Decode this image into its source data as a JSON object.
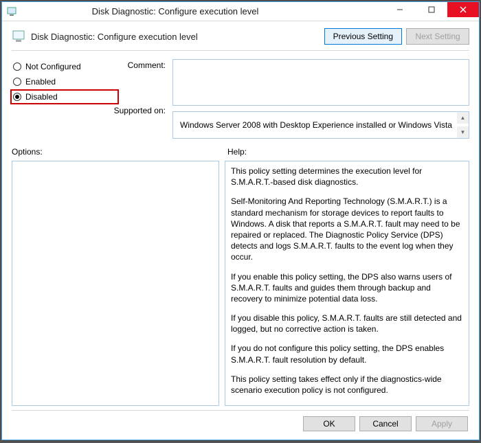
{
  "window": {
    "title": "Disk Diagnostic: Configure execution level"
  },
  "header": {
    "title": "Disk Diagnostic: Configure execution level",
    "prev_btn": "Previous Setting",
    "next_btn": "Next Setting"
  },
  "radios": {
    "not_configured": "Not Configured",
    "enabled": "Enabled",
    "disabled": "Disabled",
    "selected": "disabled"
  },
  "labels": {
    "comment": "Comment:",
    "supported": "Supported on:",
    "options": "Options:",
    "help": "Help:"
  },
  "supported_text": "Windows Server 2008 with Desktop Experience installed or Windows Vista",
  "help": {
    "p1": "This policy setting determines the execution level for S.M.A.R.T.-based disk diagnostics.",
    "p2": "Self-Monitoring And Reporting Technology (S.M.A.R.T.) is a standard mechanism for storage devices to report faults to Windows. A disk that reports a S.M.A.R.T. fault may need to be repaired or replaced. The Diagnostic Policy Service (DPS) detects and logs S.M.A.R.T. faults to the event log when they occur.",
    "p3": "If you enable this policy setting, the DPS also warns users of S.M.A.R.T. faults and guides them through backup and recovery to minimize potential data loss.",
    "p4": "If you disable this policy, S.M.A.R.T. faults are still detected and logged, but no corrective action is taken.",
    "p5": "If you do not configure this policy setting, the DPS enables S.M.A.R.T. fault resolution by default.",
    "p6": "This policy setting takes effect only if the diagnostics-wide scenario execution policy is not configured."
  },
  "buttons": {
    "ok": "OK",
    "cancel": "Cancel",
    "apply": "Apply"
  }
}
